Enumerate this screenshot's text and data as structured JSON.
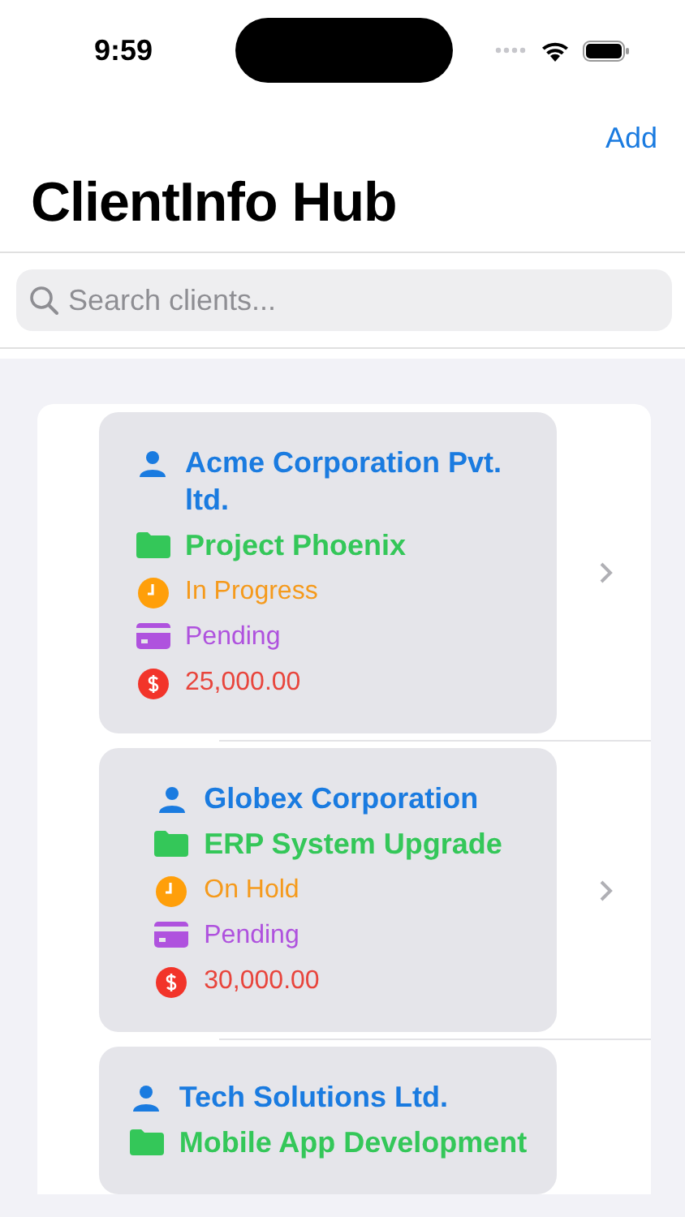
{
  "status_bar": {
    "time": "9:59"
  },
  "nav": {
    "action": "Add",
    "title": "ClientInfo Hub"
  },
  "search": {
    "placeholder": "Search clients..."
  },
  "clients": [
    {
      "name": "Acme Corporation Pvt. ltd.",
      "project": "Project Phoenix",
      "status": "In Progress",
      "payment": "Pending",
      "amount": "25,000.00"
    },
    {
      "name": "Globex Corporation",
      "project": "ERP System Upgrade",
      "status": "On Hold",
      "payment": "Pending",
      "amount": "30,000.00"
    },
    {
      "name": "Tech Solutions Ltd.",
      "project": "Mobile App Development"
    }
  ]
}
